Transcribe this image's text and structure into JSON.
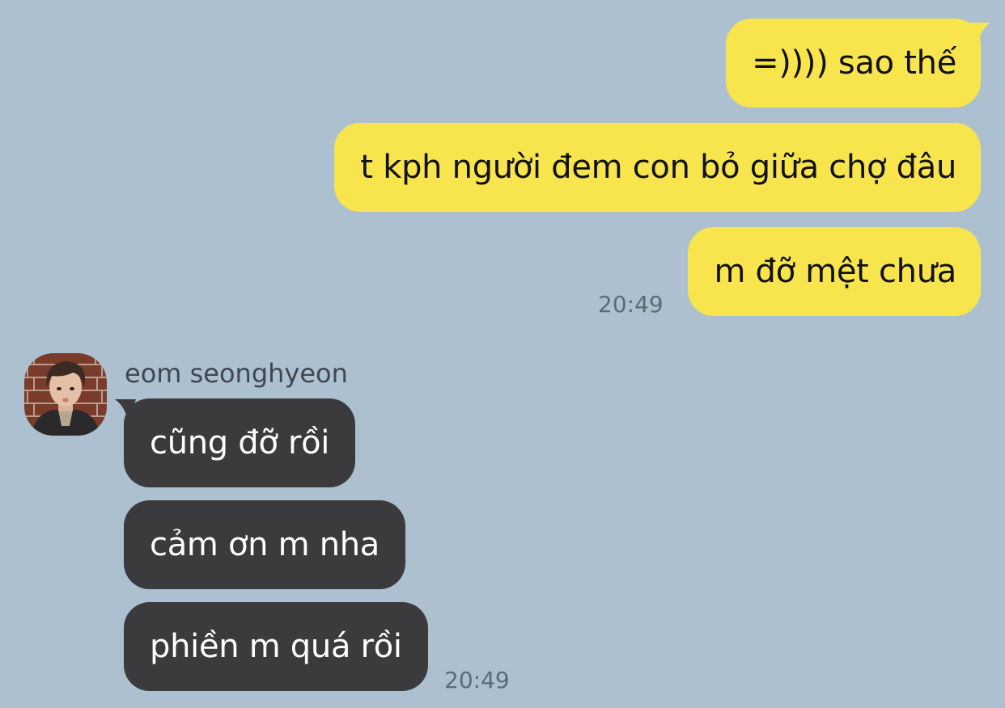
{
  "colors": {
    "background": "#adc0cf",
    "outgoing_bubble": "#f8e54e",
    "incoming_bubble": "#3b3b3e",
    "timestamp_text": "#5e6a74"
  },
  "outgoing": {
    "messages": [
      "=)))) sao thế",
      "t kph người đem con bỏ giữa chợ đâu",
      "m đỡ mệt chưa"
    ],
    "timestamp": "20:49"
  },
  "incoming": {
    "sender_name": "eom seonghyeon",
    "avatar_icon": "profile-photo",
    "messages": [
      "cũng đỡ rồi",
      "cảm ơn m nha",
      "phiền m quá rồi"
    ],
    "timestamp": "20:49"
  }
}
